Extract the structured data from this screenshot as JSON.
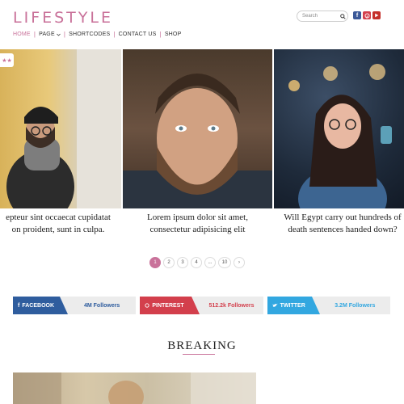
{
  "header": {
    "logo": "LIFESTYLE",
    "search": {
      "placeholder": "Search",
      "icon": "search-icon"
    },
    "social": [
      {
        "name": "facebook",
        "glyph": "f",
        "color": "#3b5998"
      },
      {
        "name": "pinterest",
        "glyph": "p",
        "color": "#d33f4c"
      },
      {
        "name": "youtube",
        "glyph": "▶",
        "color": "#c4302b"
      }
    ]
  },
  "nav": {
    "items": [
      {
        "label": "HOME",
        "active": true
      },
      {
        "label": "PAGE",
        "dropdown": true
      },
      {
        "label": "SHORTCODES"
      },
      {
        "label": "CONTACT US"
      },
      {
        "label": "SHOP"
      }
    ]
  },
  "slider": {
    "badge": "★★",
    "slides": [
      {
        "caption_line1": "epteur sint occaecat cupidatat",
        "caption_line2": "on proident, sunt in culpa."
      },
      {
        "caption_line1": "Lorem ipsum dolor sit amet,",
        "caption_line2": "consectetur adipisicing elit"
      },
      {
        "caption_line1": "Will Egypt carry out hundreds of",
        "caption_line2": "death sentences handed down?"
      }
    ]
  },
  "pagination": {
    "pages": [
      "1",
      "2",
      "3",
      "4",
      "...",
      "10",
      "›"
    ],
    "current": "1"
  },
  "social_counters": [
    {
      "network": "FACEBOOK",
      "count": "4M Followers",
      "color": "#2f5d9e"
    },
    {
      "network": "PINTEREST",
      "count": "512.2k Followers",
      "color": "#d33f4c"
    },
    {
      "network": "TWITTER",
      "count": "3.2M Followers",
      "color": "#32a7e0"
    }
  ],
  "section": {
    "title": "BREAKING"
  },
  "colors": {
    "accent": "#c9729a"
  }
}
